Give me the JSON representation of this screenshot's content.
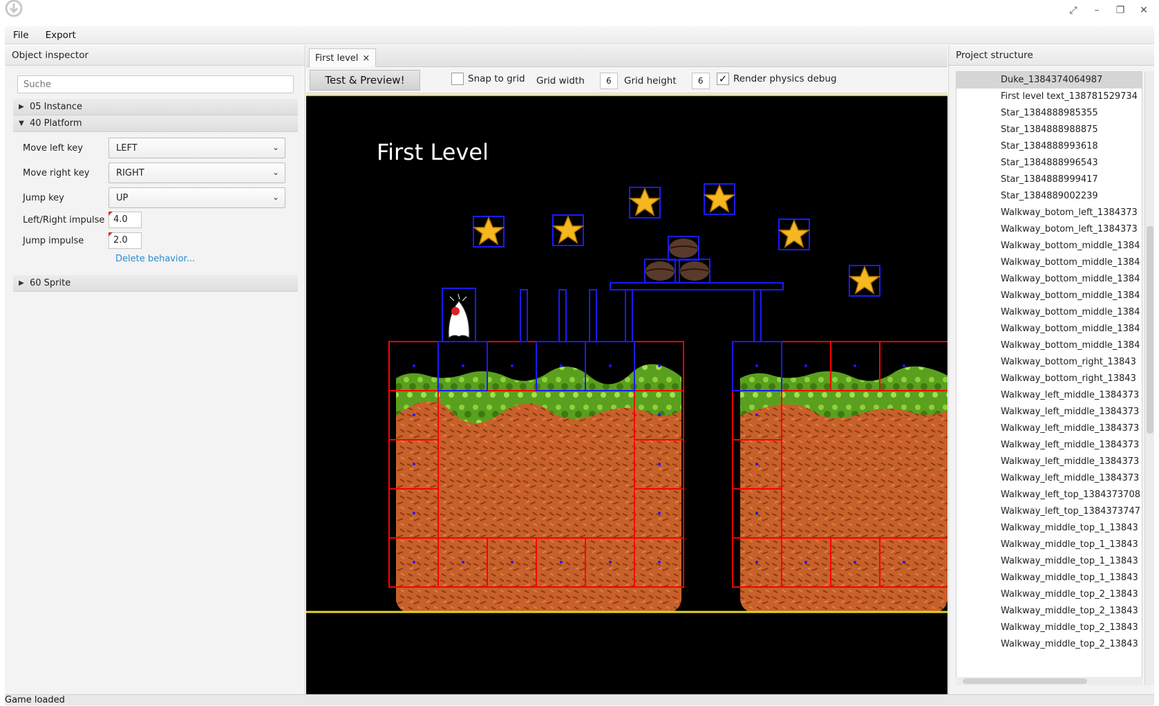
{
  "menu": {
    "file": "File",
    "export": "Export"
  },
  "left": {
    "header": "Object inspector",
    "search_placeholder": "Suche",
    "sections": {
      "instance": "05 Instance",
      "platform": "40 Platform",
      "sprite": "60 Sprite"
    },
    "props": {
      "move_left_label": "Move left key",
      "move_left_value": "LEFT",
      "move_right_label": "Move right key",
      "move_right_value": "RIGHT",
      "jump_label": "Jump key",
      "jump_value": "UP",
      "lr_impulse_label": "Left/Right impulse",
      "lr_impulse_value": "4.0",
      "jump_impulse_label": "Jump impulse",
      "jump_impulse_value": "2.0"
    },
    "delete_link": "Delete behavior..."
  },
  "center": {
    "tab_label": "First level",
    "tab_close": "×",
    "toolbar": {
      "preview_button": "Test & Preview!",
      "snap_label": "Snap to grid",
      "grid_width_label": "Grid width",
      "grid_width_value": "6",
      "grid_height_label": "Grid height",
      "grid_height_value": "6",
      "physics_label": "Render physics debug",
      "physics_checked": "✓"
    },
    "level_title": "First Level"
  },
  "right": {
    "header": "Project structure",
    "items": [
      "Duke_1384374064987",
      "First level text_138781529734",
      "Star_1384888985355",
      "Star_1384888988875",
      "Star_1384888993618",
      "Star_1384888996543",
      "Star_1384888999417",
      "Star_1384889002239",
      "Walkway_botom_left_1384373",
      "Walkway_botom_left_1384373",
      "Walkway_bottom_middle_1384",
      "Walkway_bottom_middle_1384",
      "Walkway_bottom_middle_1384",
      "Walkway_bottom_middle_1384",
      "Walkway_bottom_middle_1384",
      "Walkway_bottom_middle_1384",
      "Walkway_bottom_middle_1384",
      "Walkway_bottom_right_13843",
      "Walkway_bottom_right_13843",
      "Walkway_left_middle_1384373",
      "Walkway_left_middle_1384373",
      "Walkway_left_middle_1384373",
      "Walkway_left_middle_1384373",
      "Walkway_left_middle_1384373",
      "Walkway_left_middle_1384373",
      "Walkway_left_top_1384373708",
      "Walkway_left_top_1384373747",
      "Walkway_middle_top_1_13843",
      "Walkway_middle_top_1_13843",
      "Walkway_middle_top_1_13843",
      "Walkway_middle_top_1_13843",
      "Walkway_middle_top_2_13843",
      "Walkway_middle_top_2_13843",
      "Walkway_middle_top_2_13843",
      "Walkway_middle_top_2_13843"
    ]
  },
  "status": "Game loaded",
  "colors": {
    "debug_static": "#ff0000",
    "debug_dynamic": "#1a1aff",
    "ground": "#c8602a",
    "grass": "#5aa01e",
    "star": "#f6b820",
    "baseline": "#e3d51b"
  }
}
